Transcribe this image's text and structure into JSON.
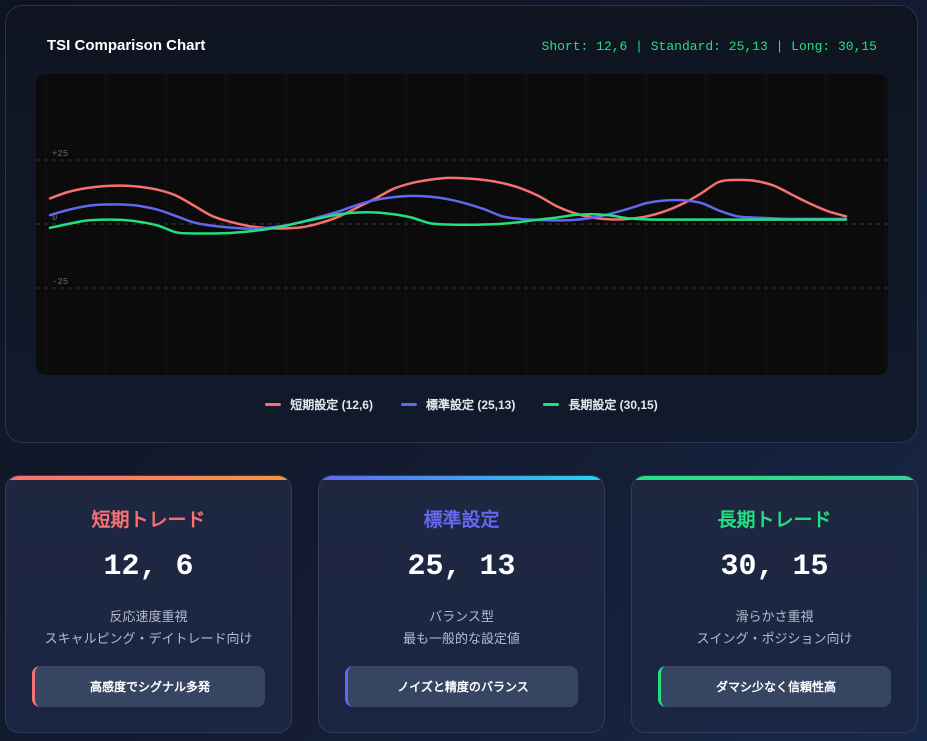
{
  "header": {
    "title": "TSI Comparison Chart",
    "params": "Short: 12,6 | Standard: 25,13 | Long: 30,15"
  },
  "chart_data": {
    "type": "line",
    "ylim": [
      -50,
      50
    ],
    "y_ticks": [
      {
        "value": 25,
        "label": "+25"
      },
      {
        "value": 0,
        "label": "0"
      },
      {
        "value": -25,
        "label": "-25"
      }
    ],
    "grid": "horizontal dashed at ticks",
    "legend_position": "bottom-center",
    "x": [
      1,
      2,
      3,
      4,
      5,
      6,
      7,
      8,
      9,
      10,
      11,
      12,
      13,
      14,
      15,
      16,
      17,
      18,
      19,
      20,
      21,
      22,
      23,
      24,
      25,
      26,
      27,
      28,
      29,
      30,
      31,
      32,
      33,
      34,
      35,
      36,
      37,
      38,
      39,
      40,
      41,
      42,
      43,
      44,
      45
    ],
    "series": [
      {
        "name": "短期設定 (12,6)",
        "color": "#f87171",
        "values": [
          10,
          12.5,
          14,
          14.8,
          15,
          14.5,
          13.3,
          11,
          7,
          3,
          0.8,
          -0.8,
          -1.6,
          -1.7,
          -1.2,
          0.5,
          3,
          6.5,
          10,
          13.8,
          16,
          17.3,
          18,
          17.8,
          17.2,
          16,
          14,
          11,
          7,
          4.2,
          2.5,
          1.8,
          2,
          3,
          5,
          8,
          12,
          16.5,
          17.2,
          16.8,
          15,
          11.5,
          8,
          5,
          3
        ]
      },
      {
        "name": "標準設定 (25,13)",
        "color": "#6366f1",
        "values": [
          3.5,
          5.5,
          7,
          7.6,
          7.6,
          7,
          5.5,
          3,
          0.5,
          -0.7,
          -1.4,
          -1.8,
          -1.5,
          -0.6,
          1,
          3,
          5,
          7.5,
          9.4,
          10.5,
          11,
          10.7,
          9.7,
          8,
          5.8,
          3,
          2,
          1.6,
          1.4,
          1.6,
          2.5,
          4,
          6,
          8.2,
          9.2,
          9.3,
          8.2,
          5.2,
          3,
          2.5,
          2.2,
          2,
          2,
          2,
          2
        ]
      },
      {
        "name": "長期設定 (30,15)",
        "color": "#22e07f",
        "values": [
          -1.5,
          0,
          1.3,
          1.7,
          1.6,
          0.8,
          -0.7,
          -3.3,
          -3.7,
          -3.7,
          -3.5,
          -2.9,
          -2,
          -0.7,
          0.9,
          2.4,
          3.8,
          4.5,
          4.5,
          3.8,
          2.5,
          0.3,
          -0.2,
          -0.3,
          -0.2,
          0.1,
          0.8,
          1.7,
          2.5,
          3.5,
          3.8,
          3.3,
          2.2,
          1.8,
          1.7,
          1.7,
          1.7,
          1.7,
          1.7,
          1.7,
          1.7,
          1.7,
          1.7,
          1.7,
          1.7
        ]
      }
    ]
  },
  "legend": {
    "short": {
      "label": "短期設定 (12,6)",
      "color": "#f87171"
    },
    "standard": {
      "label": "標準設定 (25,13)",
      "color": "#6366f1"
    },
    "long": {
      "label": "長期設定 (30,15)",
      "color": "#22e07f"
    }
  },
  "cards": [
    {
      "title": "短期トレード",
      "title_color": "#f87171",
      "bar_gradient": [
        "#f87171",
        "#fb923c"
      ],
      "values": "12, 6",
      "desc_1": "反応速度重視",
      "desc_2": "スキャルピング・デイトレード向け",
      "tag": "高感度でシグナル多発",
      "tag_accent": "#f87171"
    },
    {
      "title": "標準設定",
      "title_color": "#6366f1",
      "bar_gradient": [
        "#6366f1",
        "#22d3ee"
      ],
      "values": "25, 13",
      "desc_1": "バランス型",
      "desc_2": "最も一般的な設定値",
      "tag": "ノイズと精度のバランス",
      "tag_accent": "#6366f1"
    },
    {
      "title": "長期トレード",
      "title_color": "#22e07f",
      "bar_gradient": [
        "#22e07f",
        "#34d399"
      ],
      "values": "30, 15",
      "desc_1": "滑らかさ重視",
      "desc_2": "スイング・ポジション向け",
      "tag": "ダマシ少なく信頼性高",
      "tag_accent": "#22e07f"
    }
  ]
}
